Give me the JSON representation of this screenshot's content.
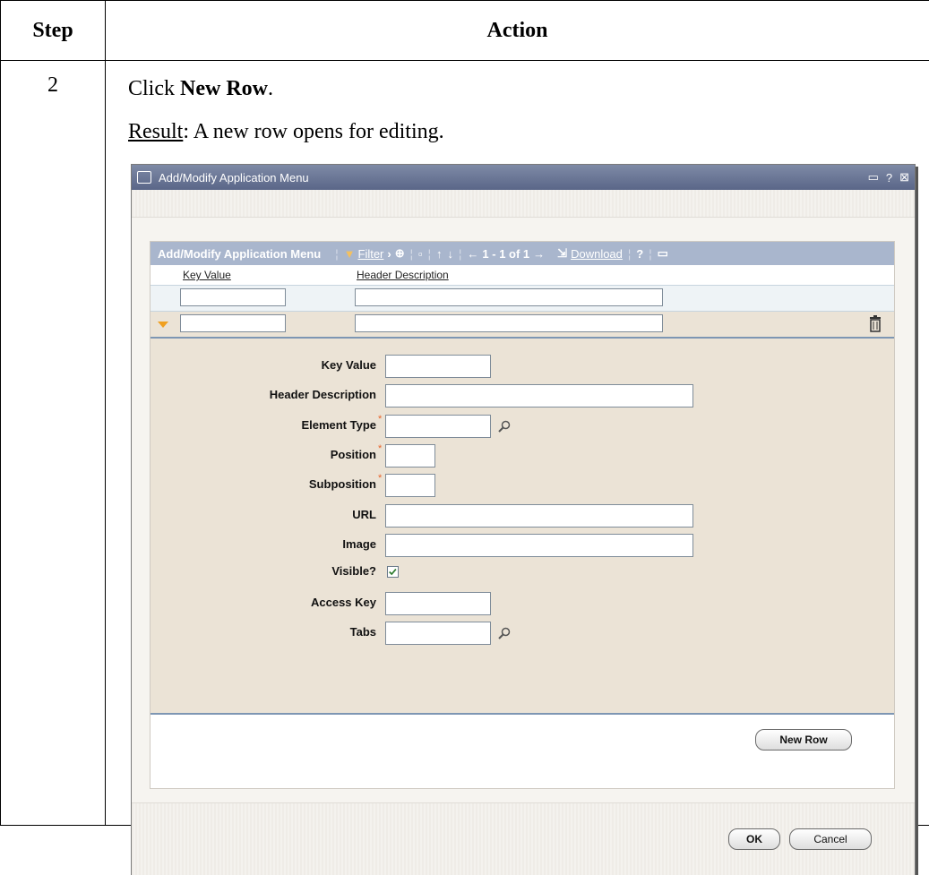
{
  "table": {
    "header_step": "Step",
    "header_action": "Action",
    "step_number": "2",
    "instruction_prefix": "Click ",
    "instruction_bold": "New Row",
    "instruction_suffix": ".",
    "result_label": "Result",
    "result_text": ": A new row opens for editing."
  },
  "dialog": {
    "title": "Add/Modify Application Menu",
    "title_controls": [
      "▭",
      "?",
      "⊠"
    ],
    "grid": {
      "title": "Add/Modify Application Menu",
      "filter_label": "Filter",
      "pagination": "1 - 1 of 1",
      "download_label": "Download",
      "help": "?",
      "columns": [
        "Key Value",
        "Header Description"
      ]
    },
    "detail_fields": [
      {
        "label": "Key Value",
        "required": false
      },
      {
        "label": "Header Description",
        "required": false
      },
      {
        "label": "Element Type",
        "required": true
      },
      {
        "label": "Position",
        "required": true
      },
      {
        "label": "Subposition",
        "required": true
      },
      {
        "label": "URL",
        "required": false
      },
      {
        "label": "Image",
        "required": false
      },
      {
        "label": "Visible?",
        "required": false,
        "checked": true
      },
      {
        "label": "Access Key",
        "required": false
      },
      {
        "label": "Tabs",
        "required": false
      }
    ],
    "required_marker": "*",
    "new_row_button": "New Row",
    "ok_button": "OK",
    "cancel_button": "Cancel"
  }
}
